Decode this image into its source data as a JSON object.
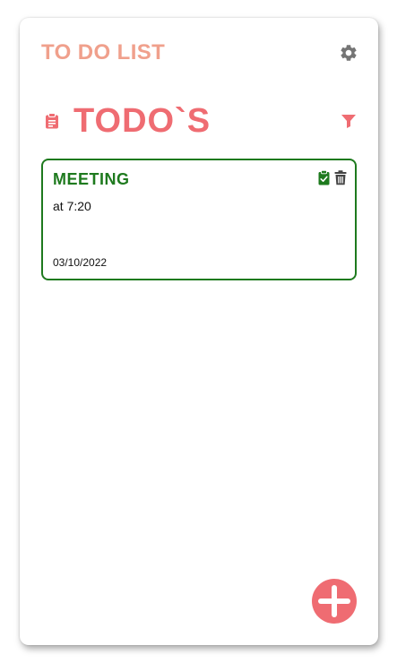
{
  "header": {
    "title": "TO DO LIST",
    "settings_icon": "gear-icon"
  },
  "section": {
    "title": "TODO`S",
    "icon": "clipboard-icon",
    "filter_icon": "filter-icon"
  },
  "todos": [
    {
      "title": "MEETING",
      "description": "at 7:20",
      "date": "03/10/2022",
      "status": "done",
      "done_icon": "clipboard-check-icon",
      "delete_icon": "trash-icon"
    }
  ],
  "fab": {
    "icon": "plus-icon"
  },
  "colors": {
    "title": "#f0a08c",
    "accent": "#ef6c72",
    "todo_done": "#1e7a1e",
    "icon_gray": "#757575",
    "delete_icon": "#444444"
  }
}
